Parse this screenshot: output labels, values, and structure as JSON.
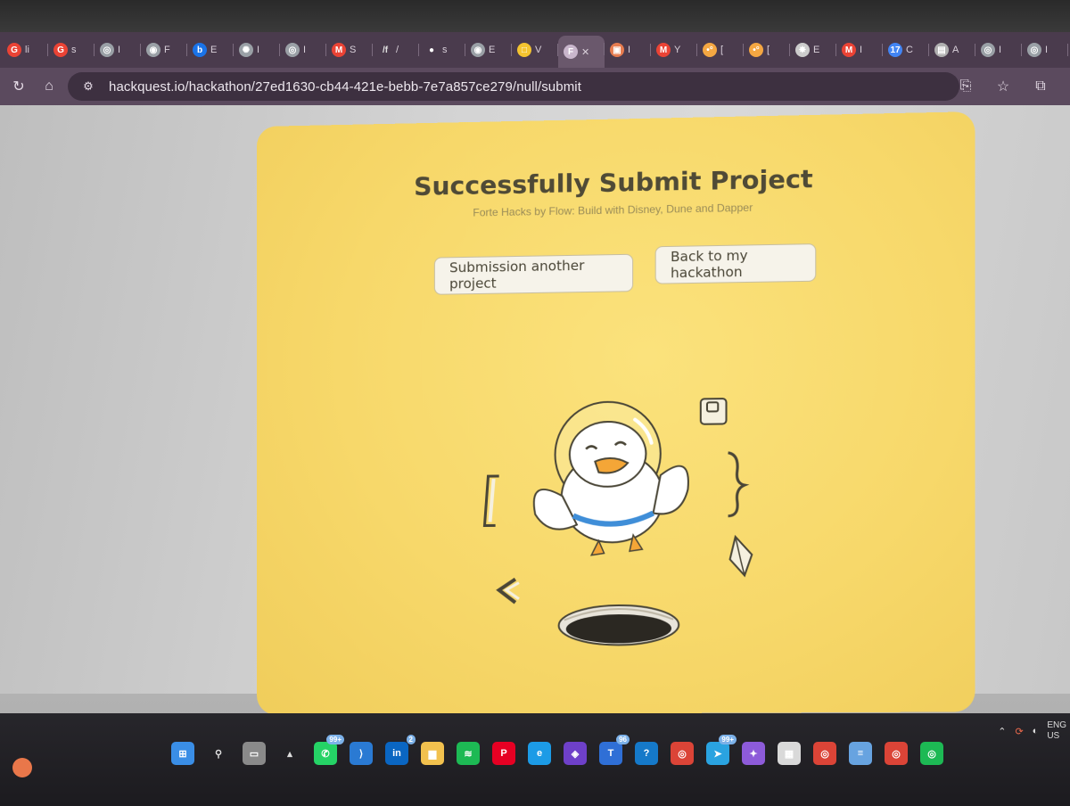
{
  "browser": {
    "tabs": [
      {
        "icon": "google-icon",
        "color": "#ea4335",
        "glyph": "G",
        "label": "li"
      },
      {
        "icon": "google-icon",
        "color": "#ea4335",
        "glyph": "G",
        "label": "s"
      },
      {
        "icon": "chrome-icon",
        "color": "#9aa0a6",
        "glyph": "◎",
        "label": "I"
      },
      {
        "icon": "globe-icon",
        "color": "#9aa0a6",
        "glyph": "◉",
        "label": "F"
      },
      {
        "icon": "app-icon",
        "color": "#1a73e8",
        "glyph": "b",
        "label": "E"
      },
      {
        "icon": "openai-icon",
        "color": "#9aa0a6",
        "glyph": "✺",
        "label": "I"
      },
      {
        "icon": "chrome-icon",
        "color": "#9aa0a6",
        "glyph": "◎",
        "label": "I"
      },
      {
        "icon": "gmail-icon",
        "color": "#ea4335",
        "glyph": "M",
        "label": "S"
      },
      {
        "icon": "slash-icon",
        "color": "#e0e0e0",
        "glyph": "/f",
        "label": "/"
      },
      {
        "icon": "github-icon",
        "color": "#ffffff",
        "glyph": "●",
        "label": "s"
      },
      {
        "icon": "globe-icon",
        "color": "#9aa0a6",
        "glyph": "◉",
        "label": "E"
      },
      {
        "icon": "hackquest-icon",
        "color": "#f4c430",
        "glyph": "□",
        "label": "V"
      },
      {
        "icon": "hackquest-tab-icon",
        "color": "#c9b6cc",
        "glyph": "F",
        "label": "✕",
        "active": true
      },
      {
        "icon": "image-icon",
        "color": "#e67c50",
        "glyph": "▣",
        "label": "I"
      },
      {
        "icon": "gmail-icon",
        "color": "#ea4335",
        "glyph": "M",
        "label": "Y"
      },
      {
        "icon": "dots-icon",
        "color": "#f4a742",
        "glyph": "•°",
        "label": "["
      },
      {
        "icon": "dots-icon",
        "color": "#f4a742",
        "glyph": "•°",
        "label": "["
      },
      {
        "icon": "star-icon",
        "color": "#cccccc",
        "glyph": "✸",
        "label": "E"
      },
      {
        "icon": "gmail-icon",
        "color": "#ea4335",
        "glyph": "M",
        "label": "I"
      },
      {
        "icon": "calendar-icon",
        "color": "#4285f4",
        "glyph": "17",
        "label": "C"
      },
      {
        "icon": "doc-icon",
        "color": "#b0b0b0",
        "glyph": "▤",
        "label": "A"
      },
      {
        "icon": "chrome-icon",
        "color": "#9aa0a6",
        "glyph": "◎",
        "label": "I"
      },
      {
        "icon": "chrome-icon",
        "color": "#9aa0a6",
        "glyph": "◎",
        "label": "I"
      },
      {
        "icon": "chrome-icon",
        "color": "#9aa0a6",
        "glyph": "◎",
        "label": "F"
      }
    ],
    "url": "hackquest.io/hackathon/27ed1630-cb44-421e-bebb-7e7a857ce279/null/submit"
  },
  "page": {
    "title": "Successfully Submit Project",
    "subtitle": "Forte Hacks by Flow: Build with Disney, Dune and Dapper",
    "submit_another_label": "Submission another project",
    "back_label": "Back to my hackathon",
    "card_color": "#f7d86a"
  },
  "taskbar": {
    "apps": [
      {
        "icon": "windows-start-icon",
        "color": "#3a8ee6",
        "glyph": "⊞"
      },
      {
        "icon": "search-icon",
        "color": "transparent",
        "glyph": "⚲"
      },
      {
        "icon": "task-view-icon",
        "color": "#8a8a8a",
        "glyph": "▭"
      },
      {
        "icon": "widgets-icon",
        "color": "transparent",
        "glyph": "▴"
      },
      {
        "icon": "whatsapp-icon",
        "color": "#25d366",
        "glyph": "✆",
        "badge": "99+"
      },
      {
        "icon": "vscode-icon",
        "color": "#2a7ad3",
        "glyph": "⟩"
      },
      {
        "icon": "linkedin-icon",
        "color": "#0a66c2",
        "glyph": "in",
        "badge": "2"
      },
      {
        "icon": "folder-icon",
        "color": "#f2c14e",
        "glyph": "▆"
      },
      {
        "icon": "spotify-icon",
        "color": "#1db954",
        "glyph": "≋"
      },
      {
        "icon": "pinterest-icon",
        "color": "#e60023",
        "glyph": "P"
      },
      {
        "icon": "edge-icon",
        "color": "#1c9be6",
        "glyph": "e"
      },
      {
        "icon": "github-desktop-icon",
        "color": "#6e40c9",
        "glyph": "◈"
      },
      {
        "icon": "teams-icon",
        "color": "#2f6fd6",
        "glyph": "T",
        "badge": "96"
      },
      {
        "icon": "edge-dev-icon",
        "color": "#1579c9",
        "glyph": "?"
      },
      {
        "icon": "chrome-icon",
        "color": "#db4437",
        "glyph": "◎"
      },
      {
        "icon": "telegram-icon",
        "color": "#2aa3e0",
        "glyph": "➤",
        "badge": "99+"
      },
      {
        "icon": "copilot-icon",
        "color": "#8d5bd9",
        "glyph": "✦"
      },
      {
        "icon": "store-icon",
        "color": "#d9d9d9",
        "glyph": "▦"
      },
      {
        "icon": "chrome-icon",
        "color": "#db4437",
        "glyph": "◎"
      },
      {
        "icon": "notepad-icon",
        "color": "#67a3e0",
        "glyph": "≡"
      },
      {
        "icon": "chrome-icon",
        "color": "#db4437",
        "glyph": "◎"
      },
      {
        "icon": "chrome-icon",
        "color": "#1db954",
        "glyph": "◎"
      }
    ],
    "tray_lang_1": "ENG",
    "tray_lang_2": "US"
  }
}
